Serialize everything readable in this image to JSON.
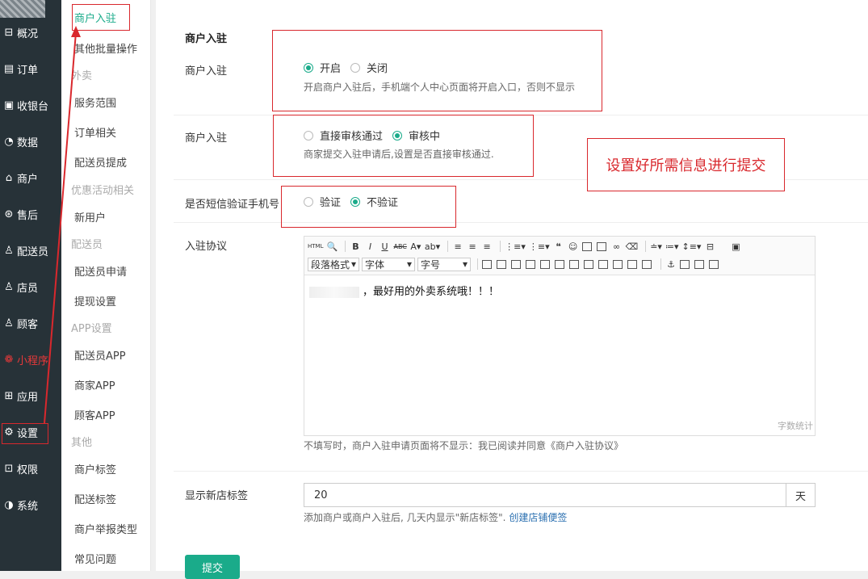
{
  "sidebar": {
    "items": [
      {
        "label": "概况",
        "icon": "overview-icon"
      },
      {
        "label": "订单",
        "icon": "order-icon"
      },
      {
        "label": "收银台",
        "icon": "cashier-icon"
      },
      {
        "label": "数据",
        "icon": "data-icon"
      },
      {
        "label": "商户",
        "icon": "merchant-icon"
      },
      {
        "label": "售后",
        "icon": "aftersale-icon"
      },
      {
        "label": "配送员",
        "icon": "courier-icon"
      },
      {
        "label": "店员",
        "icon": "clerk-icon"
      },
      {
        "label": "顾客",
        "icon": "customer-icon"
      },
      {
        "label": "小程序",
        "icon": "miniprogram-icon"
      },
      {
        "label": "应用",
        "icon": "apps-icon"
      },
      {
        "label": "设置",
        "icon": "gear-icon"
      },
      {
        "label": "权限",
        "icon": "lock-icon"
      },
      {
        "label": "系统",
        "icon": "system-icon"
      }
    ],
    "highlight_color": "#e8393a"
  },
  "subnav": {
    "items": [
      "商户入驻",
      "其他批量操作"
    ],
    "groups": [
      {
        "title": "外卖",
        "items": [
          "服务范围",
          "订单相关",
          "配送员提成"
        ]
      },
      {
        "title": "优惠活动相关",
        "items": [
          "新用户"
        ]
      },
      {
        "title": "配送员",
        "items": [
          "配送员申请",
          "提现设置"
        ]
      },
      {
        "title": "APP设置",
        "items": [
          "配送员APP",
          "商家APP",
          "顾客APP"
        ]
      },
      {
        "title": "其他",
        "items": [
          "商户标签",
          "配送标签",
          "商户举报类型",
          "常见问题"
        ]
      }
    ],
    "active_color": "#1aab8a"
  },
  "form": {
    "section_title": "商户入驻",
    "merchant_entry": {
      "label": "商户入驻",
      "options": [
        "开启",
        "关闭"
      ],
      "selected": "开启",
      "hint": "开启商户入驻后，手机端个人中心页面将开启入口，否则不显示"
    },
    "merchant_review": {
      "label": "商户入驻",
      "options": [
        "直接审核通过",
        "审核中"
      ],
      "selected": "审核中",
      "hint": "商家提交入驻申请后,设置是否直接审核通过."
    },
    "sms_verify": {
      "label": "是否短信验证手机号",
      "options": [
        "验证",
        "不验证"
      ],
      "selected": "不验证"
    },
    "agreement": {
      "label": "入驻协议",
      "toolbar": {
        "paragraph": "段落格式",
        "font": "字体",
        "font_size": "字号"
      },
      "content": "，最好用的外卖系统哦！！！",
      "word_count": "字数统计",
      "hint": "不填写时，商户入驻申请页面将不显示：我已阅读并同意《商户入驻协议》"
    },
    "new_store_tag": {
      "label": "显示新店标签",
      "value": "20",
      "unit": "天",
      "hint": "添加商户或商户入驻后, 几天内显示\"新店标签\".",
      "link": "创建店铺便签"
    },
    "submit_label": "提交"
  },
  "annotation": {
    "text": "设置好所需信息进行提交",
    "color": "#d9282d"
  },
  "accent_color": "#1aab8a"
}
